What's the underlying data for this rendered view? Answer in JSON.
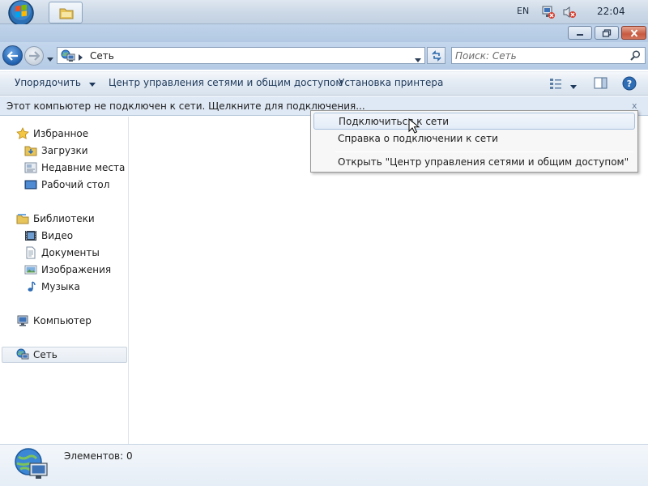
{
  "taskbar": {
    "language": "EN",
    "clock": "22:04"
  },
  "address": {
    "location": "Сеть"
  },
  "search": {
    "placeholder": "Поиск: Сеть"
  },
  "command_bar": {
    "organize": "Упорядочить",
    "network_center": "Центр управления сетями и общим доступом",
    "add_printer": "Установка принтера"
  },
  "info_bar": {
    "text": "Этот компьютер не подключен к сети. Щелкните для подключения...",
    "close": "x"
  },
  "sidebar": {
    "favorites": "Избранное",
    "downloads": "Загрузки",
    "recent": "Недавние места",
    "desktop": "Рабочий стол",
    "libraries": "Библиотеки",
    "video": "Видео",
    "documents": "Документы",
    "images": "Изображения",
    "music": "Музыка",
    "computer": "Компьютер",
    "network": "Сеть"
  },
  "context_menu": {
    "connect": "Подключиться к сети",
    "help": "Справка о подключении к сети",
    "open_center": "Открыть \"Центр управления сетями и общим доступом\""
  },
  "details": {
    "count": "Элементов: 0"
  },
  "colors": {
    "command_text": "#1e395b",
    "info_bar": "#dfe9f5",
    "close_button": "#c65a41"
  }
}
